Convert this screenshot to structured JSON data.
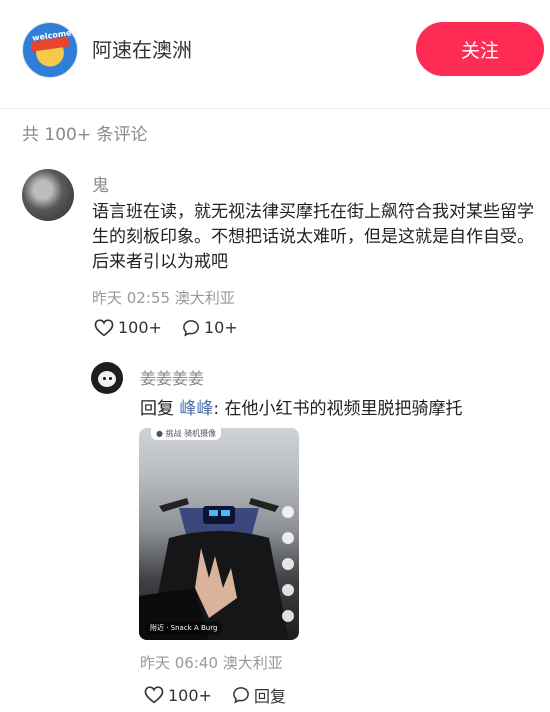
{
  "header": {
    "author_name": "阿速在澳洲",
    "avatar_text": "welcome",
    "follow_label": "关注"
  },
  "comments_header": {
    "count_text": "共 100+ 条评论"
  },
  "comment": {
    "user": "鬼",
    "text": "语言班在读，就无视法律买摩托在街上飙符合我对某些留学生的刻板印象。不想把话说太难听，但是这就是自作自受。后来者引以为戒吧",
    "time": "昨天 02:55",
    "location": "澳大利亚",
    "likes": "100+",
    "replies": "10+"
  },
  "reply": {
    "user": "姜姜姜姜",
    "prefix": "回复",
    "mention": "峰峰",
    "text": ": 在他小红书的视频里脱把骑摩托",
    "video": {
      "tag": "● 挑战 骑机摄像",
      "location": "附近 · Snack A Burg"
    },
    "time": "昨天 06:40",
    "location": "澳大利亚",
    "likes": "100+",
    "reply_label": "回复"
  },
  "colors": {
    "accent": "#fe2c55",
    "muted": "#8a8a8a",
    "mention": "#4a6fa5"
  }
}
